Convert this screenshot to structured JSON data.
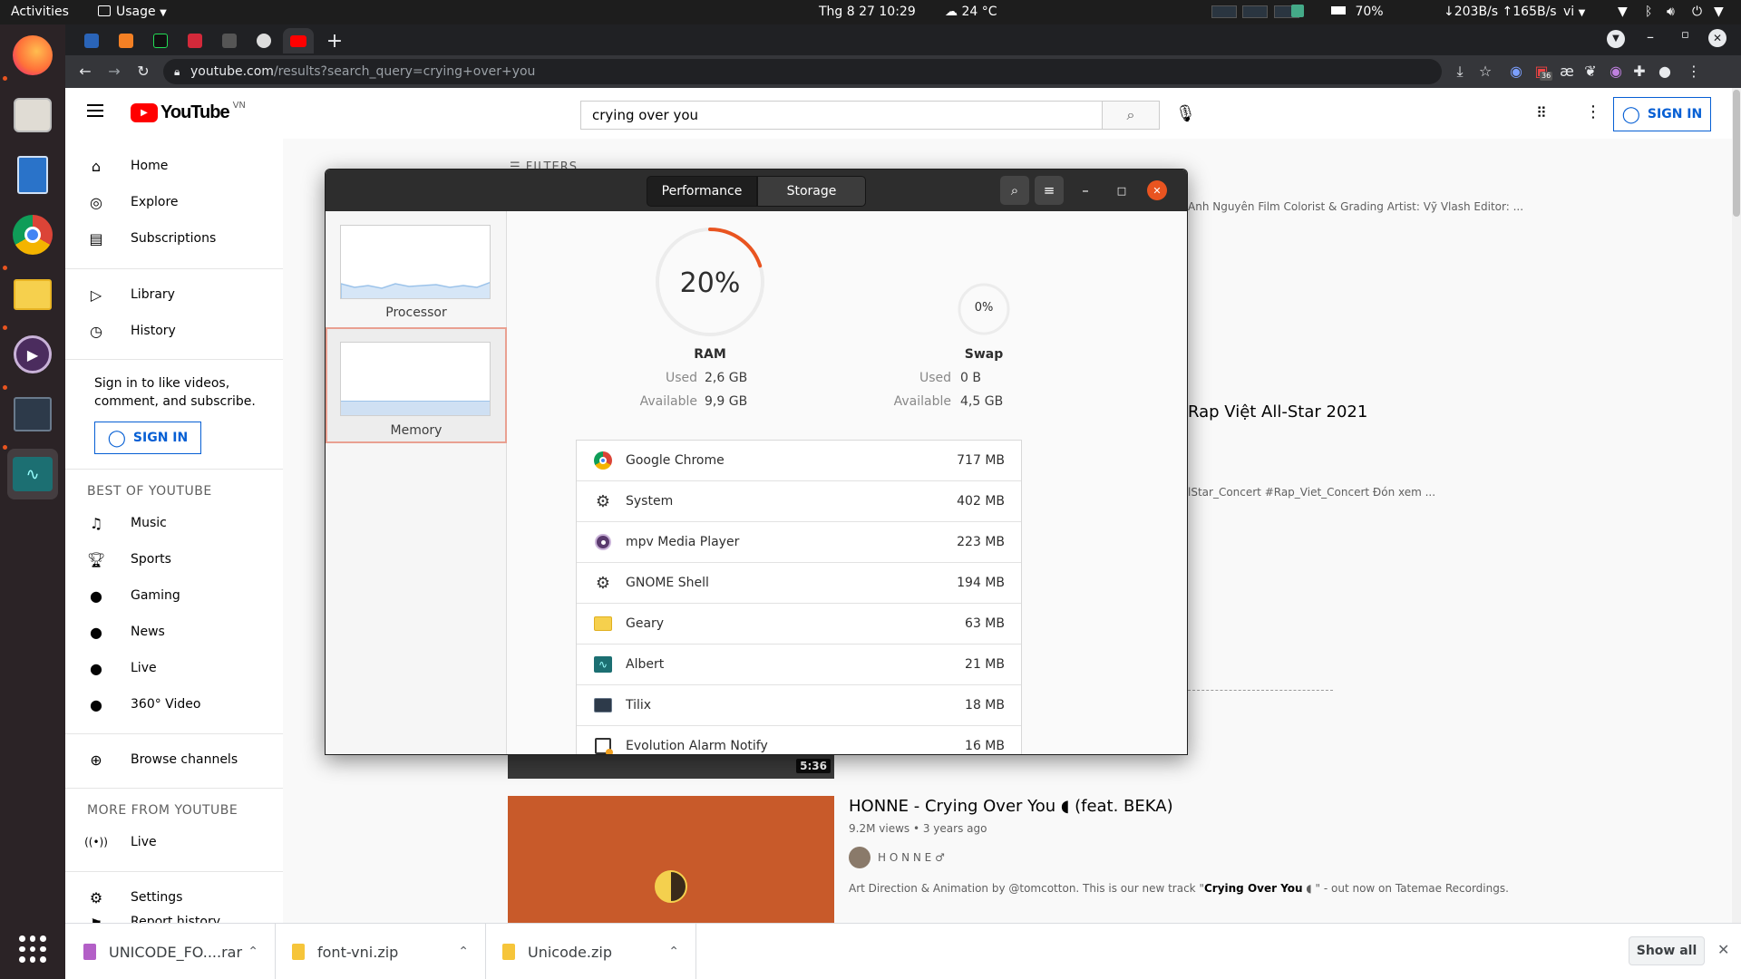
{
  "topbar": {
    "activities": "Activities",
    "app_menu": "Usage",
    "datetime": "Thg 8 27  10:29",
    "weather": "24 °C",
    "battery": "70%",
    "netspeed": "↓203B/s ↑165B/s",
    "lang": "vi"
  },
  "browser": {
    "url_host": "youtube.com",
    "url_path": "/results?search_query=crying+over+you",
    "extension_badge": "36"
  },
  "youtube": {
    "logo_text": "YouTube",
    "region": "VN",
    "search_value": "crying over you",
    "sign_in": "SIGN IN",
    "filters_label": "FILTERS",
    "sidebar": {
      "main": [
        "Home",
        "Explore",
        "Subscriptions"
      ],
      "library": [
        "Library",
        "History"
      ],
      "signin_prompt": "Sign in to like videos, comment, and subscribe.",
      "signin_button": "SIGN IN",
      "best_heading": "BEST OF YOUTUBE",
      "best": [
        "Music",
        "Sports",
        "Gaming",
        "News",
        "Live",
        "360° Video"
      ],
      "browse": "Browse channels",
      "more_heading": "MORE FROM YOUTUBE",
      "more": [
        "Live"
      ],
      "settings": "Settings",
      "report": "Report history"
    },
    "results": {
      "r1_desc": "Anh Nguyên Film Colorist & Grading Artist: Vỹ Vlash Editor: ...",
      "r2_title": "Rap Việt All-Star 2021",
      "r2_desc": "lStar_Concert #Rap_Viet_Concert Đón xem ...",
      "r3_duration": "5:36",
      "r4_title": "HONNE - Crying Over You ◖ (feat. BEKA)",
      "r4_views": "9.2M views • 3 years ago",
      "r4_channel": "H O N N E ♂",
      "r4_desc_a": "Art Direction & Animation by @tomcotton. This is our new track \"",
      "r4_desc_bold": "Crying Over You",
      "r4_desc_b": " ◖ \" - out now on Tatemae Recordings."
    }
  },
  "sysmon": {
    "tabs": [
      "Performance",
      "Storage"
    ],
    "side": {
      "processor": "Processor",
      "memory": "Memory"
    },
    "ram": {
      "percent": "20%",
      "label": "RAM",
      "used_label": "Used",
      "used": "2,6 GB",
      "avail_label": "Available",
      "avail": "9,9 GB",
      "fraction": 0.2
    },
    "swap": {
      "percent": "0%",
      "label": "Swap",
      "used_label": "Used",
      "used": "0 B",
      "avail_label": "Available",
      "avail": "4,5 GB",
      "fraction": 0
    },
    "processes": [
      {
        "name": "Google Chrome",
        "mem": "717 MB",
        "icon": "chrome-icon"
      },
      {
        "name": "System",
        "mem": "402 MB",
        "icon": "gears-icon"
      },
      {
        "name": "mpv Media Player",
        "mem": "223 MB",
        "icon": "mpv-icon"
      },
      {
        "name": "GNOME Shell",
        "mem": "194 MB",
        "icon": "gears-icon"
      },
      {
        "name": "Geary",
        "mem": "63 MB",
        "icon": "geary-icon"
      },
      {
        "name": "Albert",
        "mem": "21 MB",
        "icon": "albert-icon"
      },
      {
        "name": "Tilix",
        "mem": "18 MB",
        "icon": "tilix-icon"
      },
      {
        "name": "Evolution Alarm Notify",
        "mem": "16 MB",
        "icon": "calendar-icon"
      }
    ]
  },
  "downloads": {
    "items": [
      "UNICODE_FO....rar",
      "font-vni.zip",
      "Unicode.zip"
    ],
    "show_all": "Show all"
  },
  "colors": {
    "accent": "#e95420",
    "yt_red": "#ff0000",
    "link_blue": "#065fd4"
  }
}
